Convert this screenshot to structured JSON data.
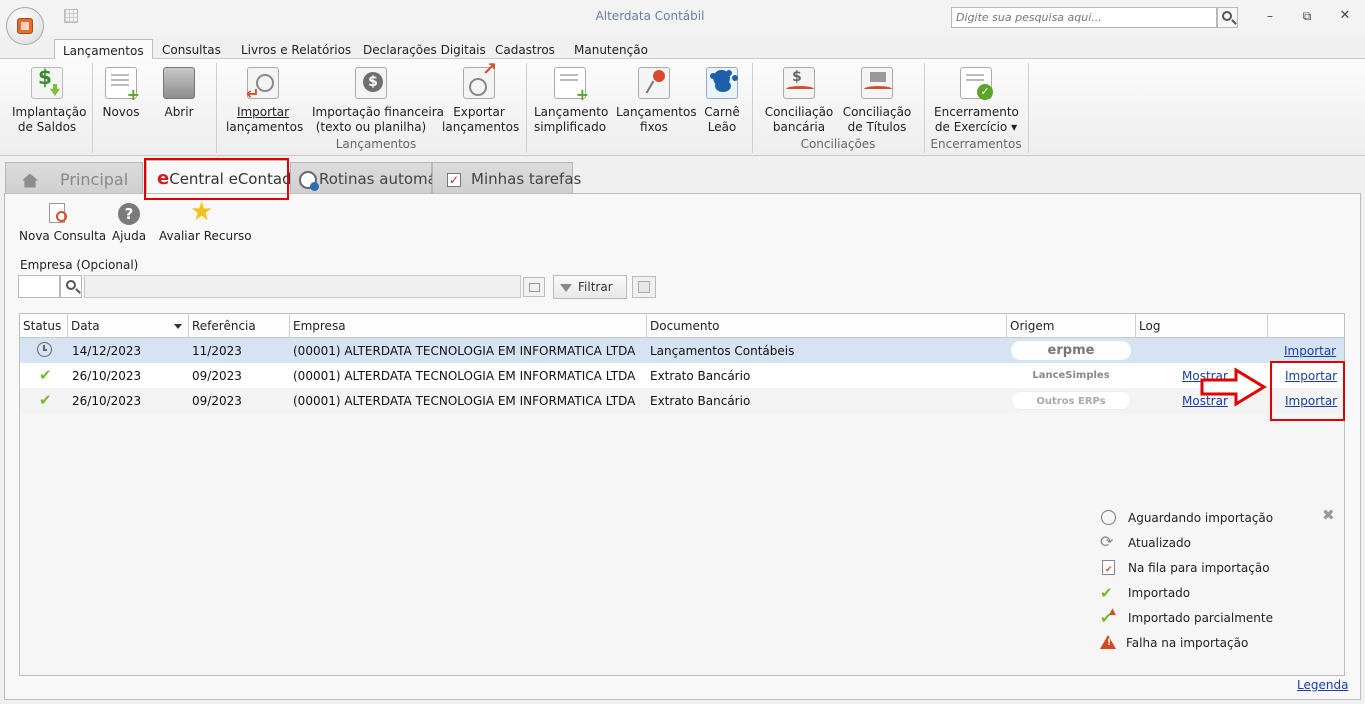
{
  "app": {
    "title": "Alterdata Contábil",
    "search_placeholder": "Digite sua pesquisa aqui..."
  },
  "menu": [
    "Lançamentos",
    "Consultas",
    "Livros e Relatórios",
    "Declarações Digitais",
    "Cadastros",
    "Manutenção"
  ],
  "ribbon": {
    "buttons": [
      {
        "l1": "Implantação",
        "l2": "de Saldos"
      },
      {
        "l1": "Novos",
        "l2": ""
      },
      {
        "l1": "Abrir",
        "l2": ""
      },
      {
        "l1": "Importar",
        "l2": "lançamentos"
      },
      {
        "l1": "Importação financeira",
        "l2": "(texto ou planilha)"
      },
      {
        "l1": "Exportar",
        "l2": "lançamentos"
      },
      {
        "l1": "Lançamento",
        "l2": "simplificado"
      },
      {
        "l1": "Lançamentos",
        "l2": "fixos"
      },
      {
        "l1": "Carnê",
        "l2": "Leão"
      },
      {
        "l1": "Conciliação",
        "l2": "bancária"
      },
      {
        "l1": "Conciliação",
        "l2": "de Títulos"
      },
      {
        "l1": "Encerramento",
        "l2": "de Exercício ▾"
      }
    ],
    "groups": [
      "Lançamentos",
      "Conciliações",
      "Encerramentos"
    ]
  },
  "tabs": [
    "Principal",
    "Central eContador",
    "Rotinas automáticas",
    "Minhas tarefas"
  ],
  "toolbar": {
    "new_query": "Nova Consulta",
    "help": "Ajuda",
    "rate": "Avaliar Recurso"
  },
  "filter": {
    "company_label": "Empresa (Opcional)",
    "filter_button": "Filtrar"
  },
  "grid": {
    "columns": [
      "Status",
      "Data",
      "Referência",
      "Empresa",
      "Documento",
      "Origem",
      "Log"
    ],
    "rows": [
      {
        "status": "clock",
        "date": "14/12/2023",
        "ref": "11/2023",
        "company": "(00001) ALTERDATA TECNOLOGIA EM INFORMATICA LTDA",
        "document": "Lançamentos Contábeis",
        "origin": "erpme",
        "log": "",
        "action": "Importar"
      },
      {
        "status": "check",
        "date": "26/10/2023",
        "ref": "09/2023",
        "company": "(00001) ALTERDATA TECNOLOGIA EM INFORMATICA LTDA",
        "document": "Extrato Bancário",
        "origin": "LanceSimples",
        "log": "Mostrar",
        "action": "Importar"
      },
      {
        "status": "check",
        "date": "26/10/2023",
        "ref": "09/2023",
        "company": "(00001) ALTERDATA TECNOLOGIA EM INFORMATICA LTDA",
        "document": "Extrato Bancário",
        "origin": "Outros ERPs",
        "log": "Mostrar",
        "action": "Importar"
      }
    ]
  },
  "legend": {
    "items": [
      "Aguardando importação",
      "Atualizado",
      "Na fila para importação",
      "Importado",
      "Importado parcialmente",
      "Falha na importação"
    ],
    "link": "Legenda"
  },
  "colors": {
    "accent": "#e00000",
    "link": "#1a3fa0",
    "selected_row": "#d5e3f3"
  }
}
